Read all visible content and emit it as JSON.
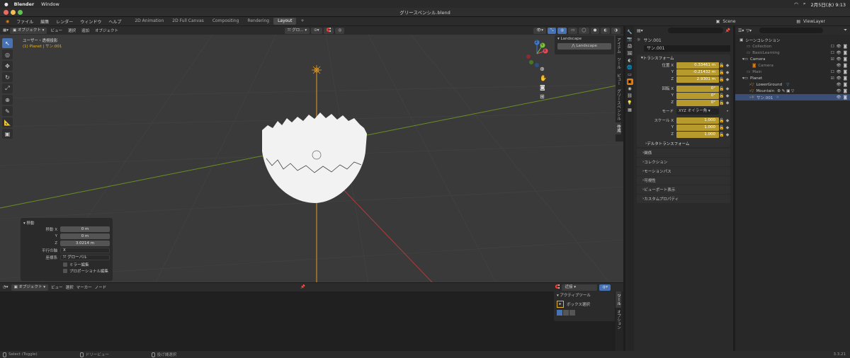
{
  "macbar": {
    "app": "Blender",
    "window": "Window",
    "clock": "2月5日(水) 9:13"
  },
  "title": "グリースペンシル.blend",
  "topmenu": {
    "items": [
      "ファイル",
      "編集",
      "レンダー",
      "ウィンドウ",
      "ヘルプ"
    ],
    "workspaces": [
      "2D Animation",
      "2D Full Canvas",
      "Compositing",
      "Rendering",
      "Layout"
    ],
    "active_workspace": "Layout",
    "scene": "Scene",
    "viewlayer": "ViewLayer"
  },
  "viewport": {
    "mode": "オブジェクト",
    "menus": [
      "ビュー",
      "選択",
      "追加",
      "オブジェクト"
    ],
    "transform_orientation": "グロ…",
    "info_line1": "ユーザー・透視投影",
    "info_line2": "(1) Planet | サン.001",
    "gizmo": {
      "x": "X",
      "y": "Y",
      "z": "Z"
    }
  },
  "npanel": {
    "header": "Landscape",
    "button": "Landscape",
    "tabs": [
      "アイテム",
      "ツール",
      "ビュー",
      "グリースペンシル",
      "作成"
    ]
  },
  "operator": {
    "title": "移動",
    "move_x_label": "移動 X",
    "move_x": "0 m",
    "move_y_label": "Y",
    "move_y": "0 m",
    "move_z_label": "Z",
    "move_z": "3.0214 m",
    "axis_label": "平行の軸",
    "axis": "X",
    "coord_label": "座標系",
    "coord": "グローバル",
    "mirror": "ミラー編集",
    "proportional": "プロポーショナル編集"
  },
  "properties": {
    "object_name": "サン.001",
    "object_field": "サン.001",
    "transform": "トランスフォーム",
    "loc_label": "位置 X",
    "loc_x": "0.33461 m",
    "loc_y": "-0.21432 m",
    "loc_z": "2.9301 m",
    "rot_label": "回転 X",
    "rot_x": "0°",
    "rot_y": "0°",
    "rot_z": "0°",
    "mode_label": "モード",
    "mode": "XYZ オイラー角",
    "scale_label": "スケール X",
    "scale_x": "1.000",
    "scale_y": "1.000",
    "scale_z": "1.000",
    "y": "Y",
    "z": "Z",
    "delta": "デルタトランスフォーム",
    "subsections": [
      "関係",
      "コレクション",
      "モーションパス",
      "可視性",
      "ビューポート表示",
      "カスタムプロパティ"
    ]
  },
  "outliner": {
    "rows": [
      {
        "name": "シーンコレクション",
        "indent": 0
      },
      {
        "name": "Collection",
        "indent": 1
      },
      {
        "name": "BasicLearning",
        "indent": 1
      },
      {
        "name": "Camera",
        "indent": 1
      },
      {
        "name": "Camera",
        "indent": 2
      },
      {
        "name": "Main",
        "indent": 1
      },
      {
        "name": "Planet",
        "indent": 1
      },
      {
        "name": "LowerGround",
        "indent": 2
      },
      {
        "name": "Mountain",
        "indent": 2
      },
      {
        "name": "サン.001",
        "indent": 2
      }
    ]
  },
  "bottom": {
    "mode": "オブジェクト",
    "menus": [
      "ビュー",
      "選択",
      "マーカー",
      "ノード"
    ],
    "search": "近接",
    "active_tool_header": "アクティブツール",
    "box_select": "ボックス選択",
    "tabs": [
      "ツール",
      "オプション"
    ]
  },
  "status": {
    "select": "Select (Toggle)",
    "dolly": "ドリービュー",
    "lasso": "投げ縄選択",
    "version": "3.3.21"
  },
  "colors": {
    "accent": "#4772b3",
    "keyframe": "#b79a2c",
    "selected_row": "#3a4e77"
  }
}
